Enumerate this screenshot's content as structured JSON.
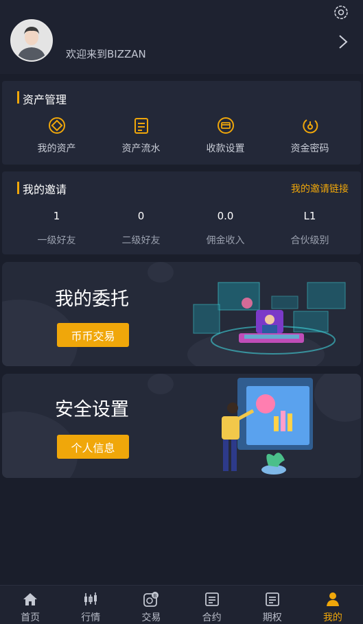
{
  "header": {
    "welcome_text": "欢迎来到BIZZAN"
  },
  "assets": {
    "title": "资产管理",
    "items": [
      {
        "label": "我的资产",
        "icon": "asset-icon"
      },
      {
        "label": "资产流水",
        "icon": "ledger-icon"
      },
      {
        "label": "收款设置",
        "icon": "card-icon"
      },
      {
        "label": "资金密码",
        "icon": "password-icon"
      }
    ]
  },
  "invite": {
    "title": "我的邀请",
    "link_label": "我的邀请链接",
    "stats": [
      {
        "value": "1",
        "label": "一级好友"
      },
      {
        "value": "0",
        "label": "二级好友"
      },
      {
        "value": "0.0",
        "label": "佣金收入"
      },
      {
        "value": "L1",
        "label": "合伙级别"
      }
    ]
  },
  "banner_orders": {
    "title": "我的委托",
    "button": "币币交易"
  },
  "banner_security": {
    "title": "安全设置",
    "button": "个人信息"
  },
  "tabbar": [
    {
      "label": "首页",
      "icon": "home-icon"
    },
    {
      "label": "行情",
      "icon": "candlestick-icon"
    },
    {
      "label": "交易",
      "icon": "trade-icon"
    },
    {
      "label": "合约",
      "icon": "contract-icon"
    },
    {
      "label": "期权",
      "icon": "option-icon"
    },
    {
      "label": "我的",
      "icon": "user-icon",
      "active": true
    }
  ],
  "colors": {
    "accent": "#f0a70a",
    "background": "#1a1e2b",
    "card": "#232838"
  }
}
